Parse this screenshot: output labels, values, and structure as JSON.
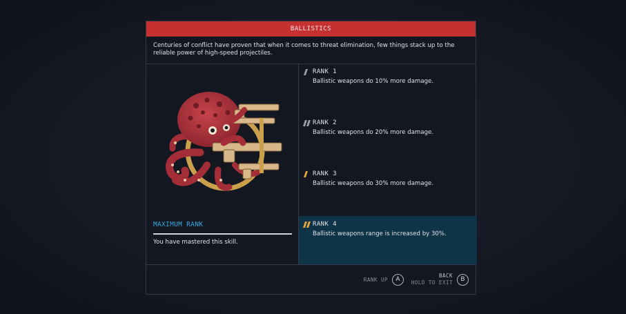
{
  "skill": {
    "title": "BALLISTICS",
    "description": "Centuries of conflict have proven that when it comes to threat elimination, few things stack up to the reliable power of high-speed projectiles.",
    "emblem_icon": "octopus-with-guns-emblem-icon"
  },
  "max_rank": {
    "title": "MAXIMUM RANK",
    "text": "You have mastered this skill."
  },
  "ranks": [
    {
      "title": "RANK 1",
      "text": "Ballistic weapons do 10% more damage.",
      "marker_color": "#9aa0a9"
    },
    {
      "title": "RANK 2",
      "text": "Ballistic weapons do 20% more damage.",
      "marker_color": "#9aa0a9"
    },
    {
      "title": "RANK 3",
      "text": "Ballistic weapons do 30% more damage.",
      "marker_color": "#e8a53a"
    },
    {
      "title": "RANK 4",
      "text": "Ballistic weapons range is increased by 30%.",
      "marker_color": "#e8a53a",
      "active": true
    }
  ],
  "footer": {
    "rank_up_label": "RANK UP",
    "rank_up_key": "A",
    "back_label": "BACK",
    "back_sub_label": "HOLD TO EXIT",
    "back_key": "B"
  },
  "colors": {
    "header": "#c43130",
    "accent_blue": "#3aa9d9",
    "active_row": "#0f3447",
    "rank_marker_gold": "#e8a53a"
  }
}
